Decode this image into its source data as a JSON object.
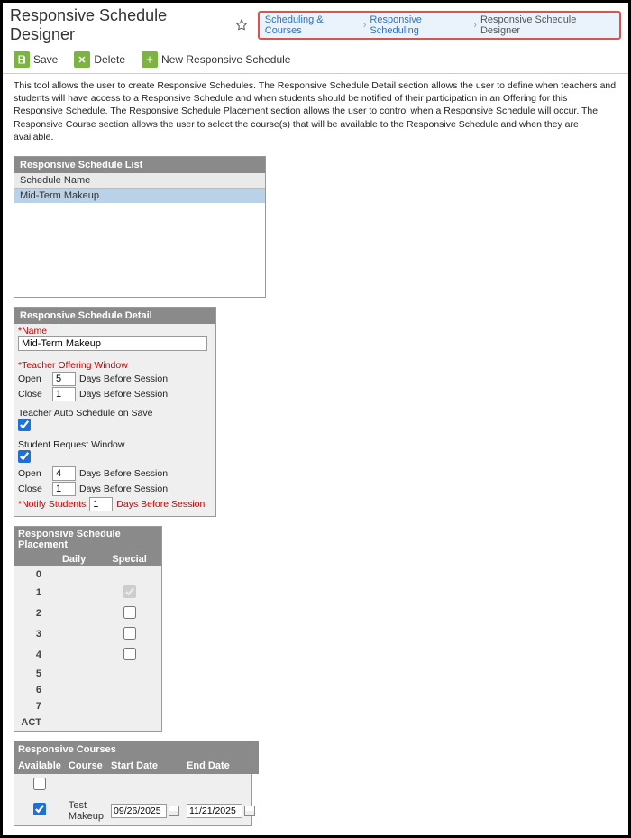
{
  "header": {
    "title": "Responsive Schedule Designer",
    "breadcrumb": {
      "items": [
        "Scheduling & Courses",
        "Responsive Scheduling",
        "Responsive Schedule Designer"
      ]
    }
  },
  "toolbar": {
    "save_label": "Save",
    "delete_label": "Delete",
    "new_label": "New Responsive Schedule"
  },
  "description": "This tool allows the user to create Responsive Schedules. The Responsive Schedule Detail section allows the user to define when teachers and students will have access to a Responsive Schedule and when students should be notified of their participation in an Offering for this Responsive Schedule. The Responsive Schedule Placement section allows the user to control when a Responsive Schedule will occur. The Responsive Course section allows the user to select the course(s) that will be available to the Responsive Schedule and when they are available.",
  "list": {
    "header": "Responsive Schedule List",
    "column": "Schedule Name",
    "rows": [
      "Mid-Term Makeup"
    ]
  },
  "detail": {
    "header": "Responsive Schedule Detail",
    "name_label": "*Name",
    "name_value": "Mid-Term Makeup",
    "teacher_window_label": "*Teacher Offering Window",
    "open_label": "Open",
    "close_label": "Close",
    "days_before_label": "Days Before Session",
    "teacher_open_value": "5",
    "teacher_close_value": "1",
    "teacher_auto_label": "Teacher Auto Schedule on Save",
    "teacher_auto_checked": true,
    "student_window_label": "Student Request Window",
    "student_window_checked": true,
    "student_open_value": "4",
    "student_close_value": "1",
    "notify_label": "*Notify Students",
    "notify_value": "1",
    "notify_suffix": "Days Before Session"
  },
  "placement": {
    "header": "Responsive Schedule Placement",
    "col_daily": "Daily",
    "col_special": "Special",
    "rows": [
      {
        "period": "0",
        "special": null
      },
      {
        "period": "1",
        "special": true,
        "disabled": true
      },
      {
        "period": "2",
        "special": false
      },
      {
        "period": "3",
        "special": false
      },
      {
        "period": "4",
        "special": false
      },
      {
        "period": "5",
        "special": null
      },
      {
        "period": "6",
        "special": null
      },
      {
        "period": "7",
        "special": null
      },
      {
        "period": "ACT",
        "special": null
      }
    ]
  },
  "courses": {
    "header": "Responsive Courses",
    "col_available": "Available",
    "col_course": "Course",
    "col_start": "Start Date",
    "col_end": "End Date",
    "rows": [
      {
        "available": false,
        "course": "",
        "start": "",
        "end": ""
      },
      {
        "available": true,
        "course": "Test Makeup",
        "start": "09/26/2025",
        "end": "11/21/2025"
      }
    ]
  }
}
